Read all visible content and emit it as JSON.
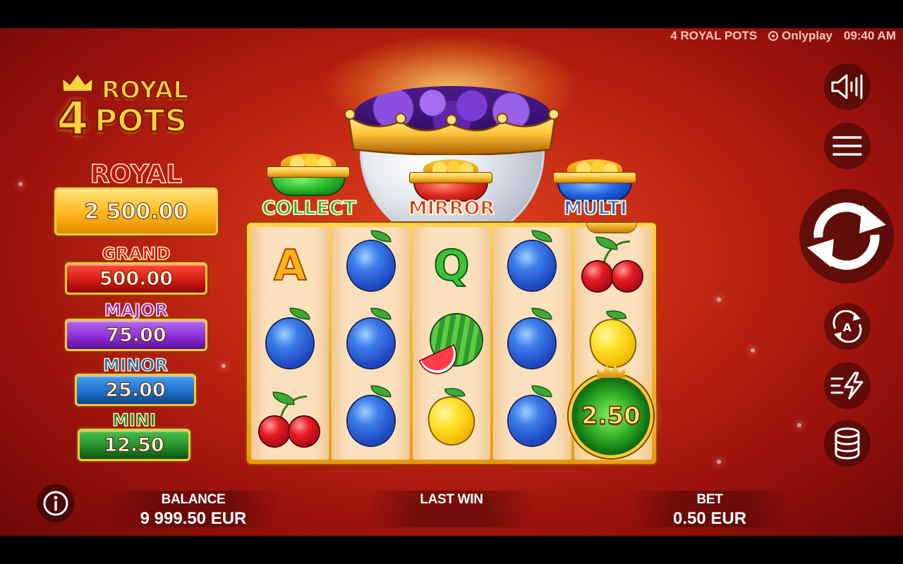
{
  "header": {
    "game_name": "4 ROYAL POTS",
    "provider": "Onlyplay",
    "time": "09:40 AM"
  },
  "logo": {
    "number": "4",
    "word1": "ROYAL",
    "word2": "POTS"
  },
  "jackpots": [
    {
      "name": "ROYAL",
      "value": "2 500.00",
      "color": "#ffb81a"
    },
    {
      "name": "GRAND",
      "value": "500.00",
      "color": "#d11a10"
    },
    {
      "name": "MAJOR",
      "value": "75.00",
      "color": "#8a2ad6"
    },
    {
      "name": "MINOR",
      "value": "25.00",
      "color": "#1a6ec8"
    },
    {
      "name": "MINI",
      "value": "12.50",
      "color": "#1e8a28"
    }
  ],
  "pots": [
    {
      "name": "COLLECT",
      "color": "#27b52a"
    },
    {
      "name": "MIRROR",
      "color": "#e1261b"
    },
    {
      "name": "MULTI",
      "color": "#1d5fe0"
    }
  ],
  "reels": [
    [
      "A",
      "plum",
      "cherries"
    ],
    [
      "plum",
      "plum",
      "plum"
    ],
    [
      "Q",
      "watermelon",
      "lemon"
    ],
    [
      "plum",
      "plum",
      "plum"
    ],
    [
      "cherries",
      "lemon",
      "coin"
    ]
  ],
  "symbol_letters": {
    "A": "A",
    "Q": "Q"
  },
  "coin_value": "2.50",
  "buttons": {
    "sound": "speaker-icon",
    "menu": "hamburger-menu-icon",
    "spin": "spin-arrows-icon",
    "autoplay": "autoplay-icon",
    "turbo": "turbo-lightning-icon",
    "bet": "coin-stack-icon",
    "info": "info-icon"
  },
  "footer": {
    "balance_label": "BALANCE",
    "balance_value": "9 999.50 EUR",
    "lastwin_label": "LAST WIN",
    "bet_label": "BET",
    "bet_value": "0.50 EUR"
  },
  "colors": {
    "gold": "#ffc63a",
    "bg_red": "#c62a14"
  }
}
